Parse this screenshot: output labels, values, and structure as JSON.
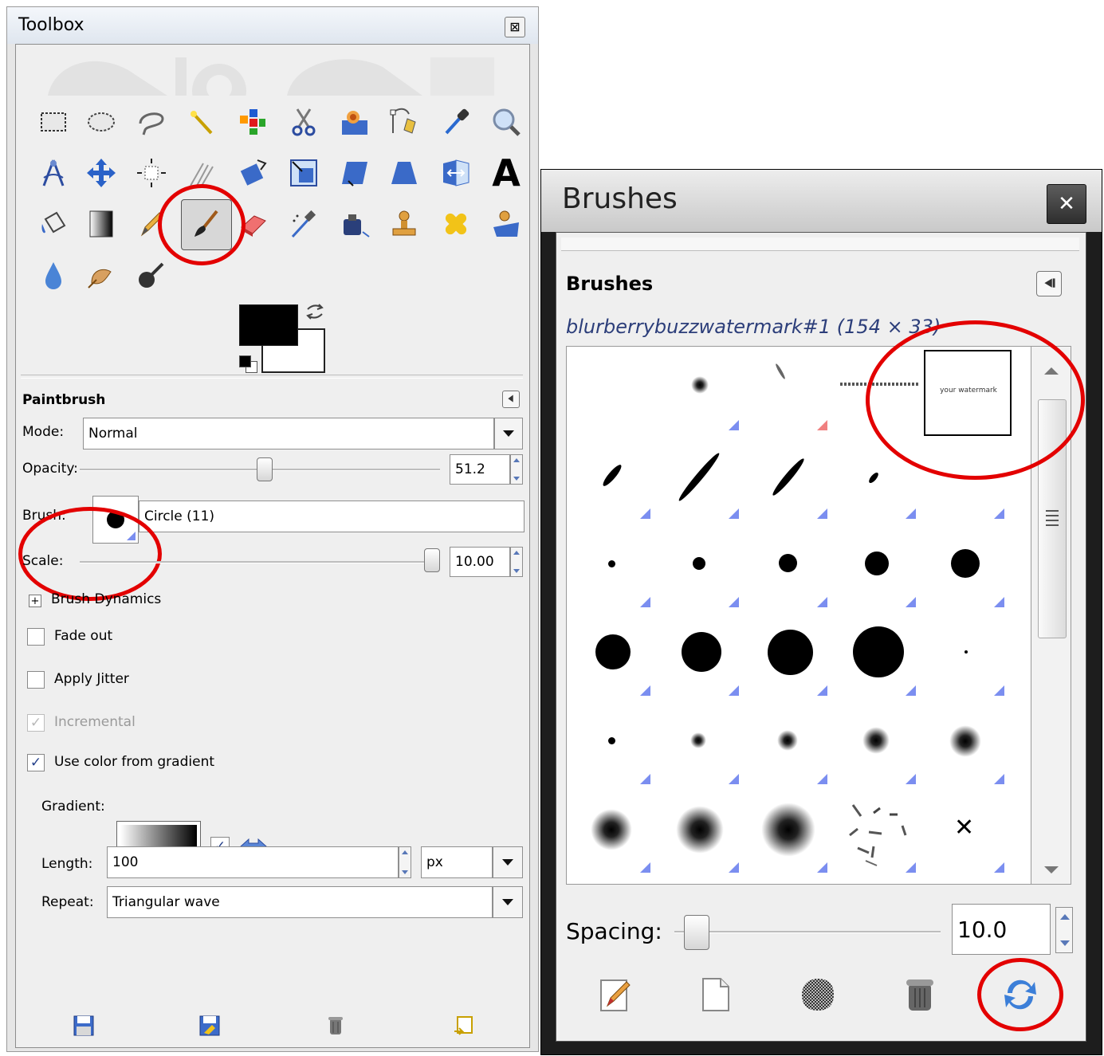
{
  "toolbox": {
    "title": "Toolbox",
    "close_glyph": "⊠",
    "tools": [
      {
        "name": "rect-select-icon"
      },
      {
        "name": "ellipse-select-icon"
      },
      {
        "name": "free-select-icon"
      },
      {
        "name": "fuzzy-select-icon"
      },
      {
        "name": "color-select-icon"
      },
      {
        "name": "scissors-select-icon"
      },
      {
        "name": "foreground-select-icon"
      },
      {
        "name": "paths-icon"
      },
      {
        "name": "color-picker-icon"
      },
      {
        "name": "zoom-icon"
      },
      {
        "name": "measure-icon"
      },
      {
        "name": "move-icon"
      },
      {
        "name": "align-icon"
      },
      {
        "name": "crop-icon"
      },
      {
        "name": "rotate-icon"
      },
      {
        "name": "scale-icon"
      },
      {
        "name": "shear-icon"
      },
      {
        "name": "perspective-icon"
      },
      {
        "name": "flip-icon"
      },
      {
        "name": "text-icon"
      },
      {
        "name": "bucket-fill-icon"
      },
      {
        "name": "blend-icon"
      },
      {
        "name": "pencil-icon"
      },
      {
        "name": "paintbrush-icon"
      },
      {
        "name": "eraser-icon"
      },
      {
        "name": "airbrush-icon"
      },
      {
        "name": "ink-icon"
      },
      {
        "name": "clone-icon"
      },
      {
        "name": "heal-icon"
      },
      {
        "name": "perspective-clone-icon"
      },
      {
        "name": "blur-icon"
      },
      {
        "name": "smudge-icon"
      },
      {
        "name": "dodge-burn-icon"
      }
    ],
    "text_tool_glyph": "A",
    "colors": {
      "foreground": "#000000",
      "background": "#ffffff"
    },
    "options": {
      "tool_name": "Paintbrush",
      "mode_label": "Mode:",
      "mode_value": "Normal",
      "opacity_label": "Opacity:",
      "opacity_value": "51.2",
      "brush_label": "Brush:",
      "brush_value": "Circle (11)",
      "scale_label": "Scale:",
      "scale_value": "10.00",
      "expander_glyph": "+",
      "brush_dynamics_label": "Brush Dynamics",
      "fade_out_label": "Fade out",
      "apply_jitter_label": "Apply Jitter",
      "incremental_label": "Incremental",
      "use_color_label": "Use color from gradient",
      "check_glyph": "✓",
      "gradient_label": "Gradient:",
      "length_label": "Length:",
      "length_value": "100",
      "length_unit": "px",
      "repeat_label": "Repeat:",
      "repeat_value": "Triangular wave"
    }
  },
  "brushes": {
    "window_title": "Brushes",
    "close_glyph": "✕",
    "heading": "Brushes",
    "selected_name": "blurberrybuzzwatermark#1 (154 × 33)",
    "preview_text": "your watermark",
    "spacing_label": "Spacing:",
    "spacing_value": "10.0",
    "cross_glyph": "✕"
  }
}
